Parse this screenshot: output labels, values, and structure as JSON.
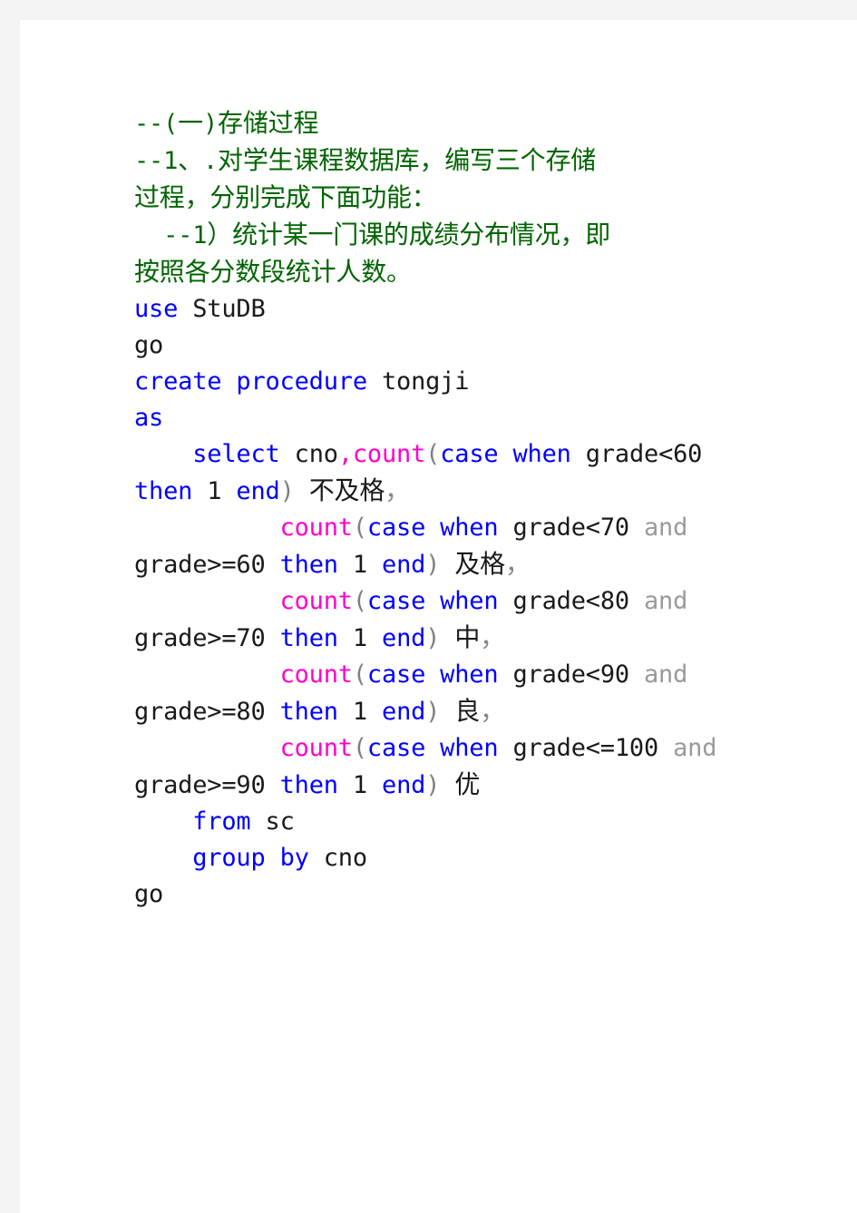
{
  "document": {
    "page_background": "#ffffff",
    "margin_background": "#f4f4f5",
    "colors": {
      "comment_green": "#006400",
      "keyword_blue": "#0000ff",
      "function_magenta": "#ff00cc",
      "identifier_black": "#1a1a1a",
      "punctuation_gray": "#808080"
    },
    "language": "SQL",
    "lines": [
      {
        "id": "line-1",
        "type": "comment",
        "text": "--(一)存储过程"
      },
      {
        "id": "line-2",
        "type": "comment",
        "text": "--1、.对学生课程数据库，编写三个存储"
      },
      {
        "id": "line-3",
        "type": "comment",
        "text": "过程，分别完成下面功能："
      },
      {
        "id": "line-4",
        "type": "comment",
        "text": "  --1）统计某一门课的成绩分布情况，即"
      },
      {
        "id": "line-5",
        "type": "comment",
        "text": "按照各分数段统计人数。"
      },
      {
        "id": "line-6",
        "type": "code",
        "tokens": [
          {
            "t": "use",
            "c": "keyword"
          },
          {
            "t": " ",
            "c": "plain"
          },
          {
            "t": "StuDB",
            "c": "ident"
          }
        ]
      },
      {
        "id": "line-7",
        "type": "code",
        "tokens": [
          {
            "t": "go",
            "c": "ident"
          }
        ]
      },
      {
        "id": "line-8",
        "type": "code",
        "tokens": [
          {
            "t": "create procedure",
            "c": "keyword"
          },
          {
            "t": " ",
            "c": "plain"
          },
          {
            "t": "tongji",
            "c": "ident"
          }
        ]
      },
      {
        "id": "line-9",
        "type": "code",
        "tokens": [
          {
            "t": "as",
            "c": "keyword"
          }
        ]
      },
      {
        "id": "line-10",
        "type": "code",
        "tokens": [
          {
            "t": "    ",
            "c": "plain"
          },
          {
            "t": "select",
            "c": "keyword"
          },
          {
            "t": " ",
            "c": "plain"
          },
          {
            "t": "cno",
            "c": "ident"
          },
          {
            "t": ",",
            "c": "func"
          },
          {
            "t": "count",
            "c": "func"
          },
          {
            "t": "(",
            "c": "punct"
          },
          {
            "t": "case when",
            "c": "keyword"
          },
          {
            "t": " ",
            "c": "plain"
          },
          {
            "t": "grade",
            "c": "ident"
          },
          {
            "t": "<",
            "c": "op"
          },
          {
            "t": "60",
            "c": "num"
          },
          {
            "t": " ",
            "c": "plain"
          },
          {
            "t": "then",
            "c": "keyword"
          },
          {
            "t": " ",
            "c": "plain"
          },
          {
            "t": "1",
            "c": "num"
          },
          {
            "t": " ",
            "c": "plain"
          },
          {
            "t": "end",
            "c": "keyword"
          },
          {
            "t": ")",
            "c": "punct"
          },
          {
            "t": " ",
            "c": "plain"
          },
          {
            "t": "不及格",
            "c": "alias-cjk"
          },
          {
            "t": "，",
            "c": "comma-cjk"
          }
        ]
      },
      {
        "id": "line-11",
        "type": "code",
        "tokens": [
          {
            "t": "          ",
            "c": "plain"
          },
          {
            "t": "count",
            "c": "func"
          },
          {
            "t": "(",
            "c": "punct"
          },
          {
            "t": "case when",
            "c": "keyword"
          },
          {
            "t": " ",
            "c": "plain"
          },
          {
            "t": "grade",
            "c": "ident"
          },
          {
            "t": "<",
            "c": "op"
          },
          {
            "t": "70",
            "c": "num"
          },
          {
            "t": " ",
            "c": "plain"
          },
          {
            "t": "and",
            "c": "and"
          },
          {
            "t": " ",
            "c": "plain"
          },
          {
            "t": "grade",
            "c": "ident"
          },
          {
            "t": ">=",
            "c": "op"
          },
          {
            "t": "60",
            "c": "num"
          },
          {
            "t": " ",
            "c": "plain"
          },
          {
            "t": "then",
            "c": "keyword"
          },
          {
            "t": " ",
            "c": "plain"
          },
          {
            "t": "1",
            "c": "num"
          },
          {
            "t": " ",
            "c": "plain"
          },
          {
            "t": "end",
            "c": "keyword"
          },
          {
            "t": ")",
            "c": "punct"
          },
          {
            "t": " ",
            "c": "plain"
          },
          {
            "t": "及格",
            "c": "alias-cjk"
          },
          {
            "t": "，",
            "c": "comma-cjk"
          }
        ]
      },
      {
        "id": "line-12",
        "type": "code",
        "tokens": [
          {
            "t": "          ",
            "c": "plain"
          },
          {
            "t": "count",
            "c": "func"
          },
          {
            "t": "(",
            "c": "punct"
          },
          {
            "t": "case when",
            "c": "keyword"
          },
          {
            "t": " ",
            "c": "plain"
          },
          {
            "t": "grade",
            "c": "ident"
          },
          {
            "t": "<",
            "c": "op"
          },
          {
            "t": "80",
            "c": "num"
          },
          {
            "t": " ",
            "c": "plain"
          },
          {
            "t": "and",
            "c": "and"
          },
          {
            "t": " ",
            "c": "plain"
          },
          {
            "t": "grade",
            "c": "ident"
          },
          {
            "t": ">=",
            "c": "op"
          },
          {
            "t": "70",
            "c": "num"
          },
          {
            "t": " ",
            "c": "plain"
          },
          {
            "t": "then",
            "c": "keyword"
          },
          {
            "t": " ",
            "c": "plain"
          },
          {
            "t": "1",
            "c": "num"
          },
          {
            "t": " ",
            "c": "plain"
          },
          {
            "t": "end",
            "c": "keyword"
          },
          {
            "t": ")",
            "c": "punct"
          },
          {
            "t": " ",
            "c": "plain"
          },
          {
            "t": "中",
            "c": "alias-cjk"
          },
          {
            "t": "，",
            "c": "comma-cjk"
          }
        ]
      },
      {
        "id": "line-13",
        "type": "code",
        "tokens": [
          {
            "t": "          ",
            "c": "plain"
          },
          {
            "t": "count",
            "c": "func"
          },
          {
            "t": "(",
            "c": "punct"
          },
          {
            "t": "case when",
            "c": "keyword"
          },
          {
            "t": " ",
            "c": "plain"
          },
          {
            "t": "grade",
            "c": "ident"
          },
          {
            "t": "<",
            "c": "op"
          },
          {
            "t": "90",
            "c": "num"
          },
          {
            "t": " ",
            "c": "plain"
          },
          {
            "t": "and",
            "c": "and"
          },
          {
            "t": " ",
            "c": "plain"
          },
          {
            "t": "grade",
            "c": "ident"
          },
          {
            "t": ">=",
            "c": "op"
          },
          {
            "t": "80",
            "c": "num"
          },
          {
            "t": " ",
            "c": "plain"
          },
          {
            "t": "then",
            "c": "keyword"
          },
          {
            "t": " ",
            "c": "plain"
          },
          {
            "t": "1",
            "c": "num"
          },
          {
            "t": " ",
            "c": "plain"
          },
          {
            "t": "end",
            "c": "keyword"
          },
          {
            "t": ")",
            "c": "punct"
          },
          {
            "t": " ",
            "c": "plain"
          },
          {
            "t": "良",
            "c": "alias-cjk"
          },
          {
            "t": "，",
            "c": "comma-cjk"
          }
        ]
      },
      {
        "id": "line-14",
        "type": "code",
        "tokens": [
          {
            "t": "          ",
            "c": "plain"
          },
          {
            "t": "count",
            "c": "func"
          },
          {
            "t": "(",
            "c": "punct"
          },
          {
            "t": "case when",
            "c": "keyword"
          },
          {
            "t": " ",
            "c": "plain"
          },
          {
            "t": "grade",
            "c": "ident"
          },
          {
            "t": "<=",
            "c": "op"
          },
          {
            "t": "100",
            "c": "num"
          },
          {
            "t": " ",
            "c": "plain"
          },
          {
            "t": "and",
            "c": "and"
          },
          {
            "t": " ",
            "c": "plain"
          },
          {
            "t": "grade",
            "c": "ident"
          },
          {
            "t": ">=",
            "c": "op"
          },
          {
            "t": "90",
            "c": "num"
          },
          {
            "t": " ",
            "c": "plain"
          },
          {
            "t": "then",
            "c": "keyword"
          },
          {
            "t": " ",
            "c": "plain"
          },
          {
            "t": "1",
            "c": "num"
          },
          {
            "t": " ",
            "c": "plain"
          },
          {
            "t": "end",
            "c": "keyword"
          },
          {
            "t": ")",
            "c": "punct"
          },
          {
            "t": " ",
            "c": "plain"
          },
          {
            "t": "优",
            "c": "alias-cjk"
          }
        ]
      },
      {
        "id": "line-15",
        "type": "code",
        "tokens": [
          {
            "t": "    ",
            "c": "plain"
          },
          {
            "t": "from",
            "c": "keyword"
          },
          {
            "t": " ",
            "c": "plain"
          },
          {
            "t": "sc",
            "c": "ident"
          }
        ]
      },
      {
        "id": "line-16",
        "type": "code",
        "tokens": [
          {
            "t": "    ",
            "c": "plain"
          },
          {
            "t": "group by",
            "c": "keyword"
          },
          {
            "t": " ",
            "c": "plain"
          },
          {
            "t": "cno",
            "c": "ident"
          }
        ]
      },
      {
        "id": "line-17",
        "type": "code",
        "tokens": [
          {
            "t": "go",
            "c": "ident"
          }
        ]
      }
    ]
  }
}
